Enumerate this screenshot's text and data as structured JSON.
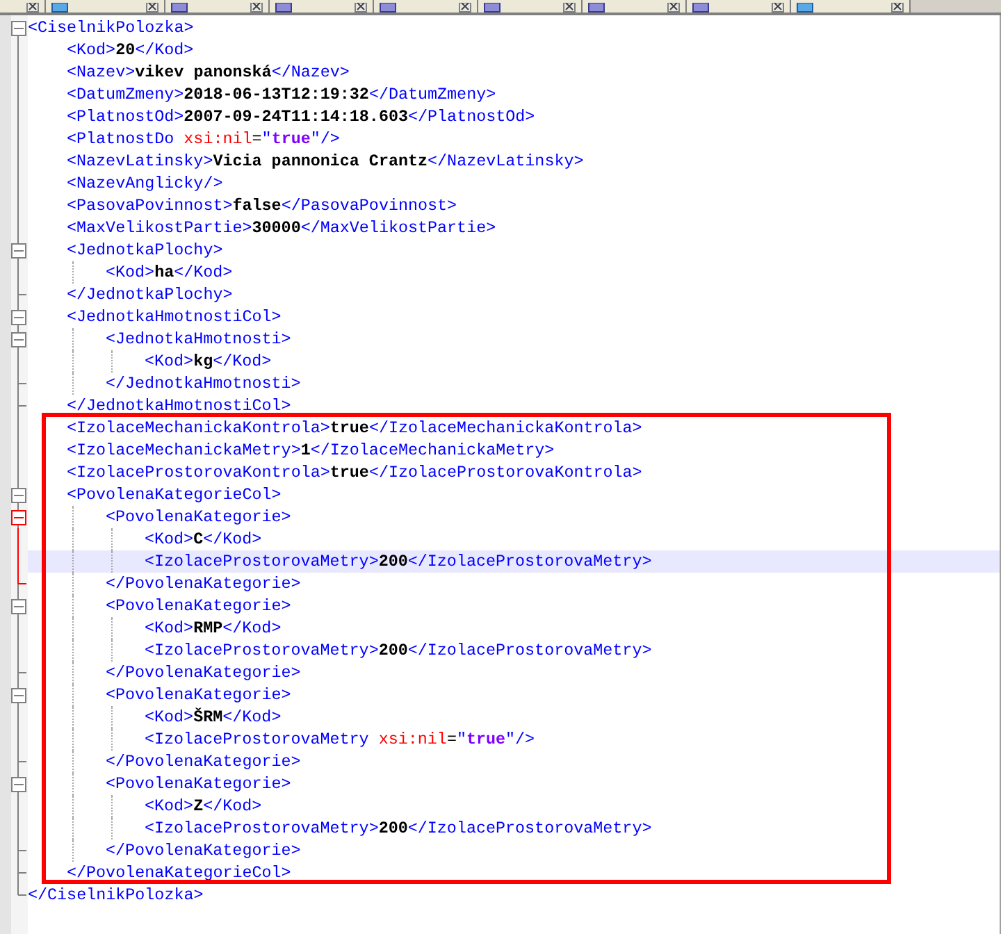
{
  "tabs": [
    {
      "kind": "partial",
      "selected": false
    },
    {
      "kind": "text-file",
      "selected": false
    },
    {
      "kind": "new-file",
      "selected": false
    },
    {
      "kind": "new-file",
      "selected": false
    },
    {
      "kind": "new-file",
      "selected": false
    },
    {
      "kind": "new-file",
      "selected": false
    },
    {
      "kind": "new-file",
      "selected": false
    },
    {
      "kind": "new-file",
      "selected": false
    },
    {
      "kind": "text-file",
      "selected": false
    }
  ],
  "document": {
    "line": [
      {
        "kind": "tag",
        "text": "<CiselnikPolozka>"
      }
    ],
    "expanded": true,
    "current": false,
    "close": [
      {
        "kind": "tag",
        "text": "</CiselnikPolozka>"
      }
    ],
    "children": [
      {
        "kind": "element",
        "current": false,
        "line": [
          {
            "kind": "tag",
            "text": "<Kod>"
          },
          {
            "kind": "text",
            "text": "20"
          },
          {
            "kind": "tag",
            "text": "</Kod>"
          }
        ]
      },
      {
        "kind": "element",
        "current": false,
        "line": [
          {
            "kind": "tag",
            "text": "<Nazev>"
          },
          {
            "kind": "text",
            "text": "vikev panonská"
          },
          {
            "kind": "tag",
            "text": "</Nazev>"
          }
        ]
      },
      {
        "kind": "element",
        "current": false,
        "line": [
          {
            "kind": "tag",
            "text": "<DatumZmeny>"
          },
          {
            "kind": "text",
            "text": "2018-06-13T12:19:32"
          },
          {
            "kind": "tag",
            "text": "</DatumZmeny>"
          }
        ]
      },
      {
        "kind": "element",
        "current": false,
        "line": [
          {
            "kind": "tag",
            "text": "<PlatnostOd>"
          },
          {
            "kind": "text",
            "text": "2007-09-24T11:14:18.603"
          },
          {
            "kind": "tag",
            "text": "</PlatnostOd>"
          }
        ]
      },
      {
        "kind": "element",
        "current": false,
        "line": [
          {
            "kind": "tag",
            "text": "<PlatnostDo "
          },
          {
            "kind": "attr",
            "text": "xsi:nil"
          },
          {
            "kind": "eq",
            "text": "="
          },
          {
            "kind": "tag",
            "text": "\""
          },
          {
            "kind": "attrval",
            "text": "true"
          },
          {
            "kind": "tag",
            "text": "\"/>"
          }
        ]
      },
      {
        "kind": "element",
        "current": false,
        "line": [
          {
            "kind": "tag",
            "text": "<NazevLatinsky>"
          },
          {
            "kind": "text",
            "text": "Vicia pannonica Crantz"
          },
          {
            "kind": "tag",
            "text": "</NazevLatinsky>"
          }
        ]
      },
      {
        "kind": "element",
        "current": false,
        "line": [
          {
            "kind": "tag",
            "text": "<NazevAnglicky/>"
          }
        ]
      },
      {
        "kind": "element",
        "current": false,
        "line": [
          {
            "kind": "tag",
            "text": "<PasovaPovinnost>"
          },
          {
            "kind": "text",
            "text": "false"
          },
          {
            "kind": "tag",
            "text": "</PasovaPovinnost>"
          }
        ]
      },
      {
        "kind": "element",
        "current": false,
        "line": [
          {
            "kind": "tag",
            "text": "<MaxVelikostPartie>"
          },
          {
            "kind": "text",
            "text": "30000"
          },
          {
            "kind": "tag",
            "text": "</MaxVelikostPartie>"
          }
        ]
      },
      {
        "kind": "element",
        "current": false,
        "expanded": true,
        "line": [
          {
            "kind": "tag",
            "text": "<JednotkaPlochy>"
          }
        ],
        "close": [
          {
            "kind": "tag",
            "text": "</JednotkaPlochy>"
          }
        ],
        "children": [
          {
            "current": false,
            "line": [
              {
                "kind": "tag",
                "text": "<Kod>"
              },
              {
                "kind": "text",
                "text": "ha"
              },
              {
                "kind": "tag",
                "text": "</Kod>"
              }
            ]
          }
        ]
      },
      {
        "kind": "element",
        "current": false,
        "expanded": true,
        "line": [
          {
            "kind": "tag",
            "text": "<JednotkaHmotnostiCol>"
          }
        ],
        "close": [
          {
            "kind": "tag",
            "text": "</JednotkaHmotnostiCol>"
          }
        ],
        "children": [
          {
            "current": false,
            "expanded": true,
            "line": [
              {
                "kind": "tag",
                "text": "<JednotkaHmotnosti>"
              }
            ],
            "close": [
              {
                "kind": "tag",
                "text": "</JednotkaHmotnosti>"
              }
            ],
            "children": [
              {
                "current": false,
                "line": [
                  {
                    "kind": "tag",
                    "text": "<Kod>"
                  },
                  {
                    "kind": "text",
                    "text": "kg"
                  },
                  {
                    "kind": "tag",
                    "text": "</Kod>"
                  }
                ]
              }
            ]
          }
        ]
      },
      {
        "kind": "annotation",
        "children": [
          {
            "current": false,
            "line": [
              {
                "kind": "tag",
                "text": "<IzolaceMechanickaKontrola>"
              },
              {
                "kind": "text",
                "text": "true"
              },
              {
                "kind": "tag",
                "text": "</IzolaceMechanickaKontrola>"
              }
            ]
          },
          {
            "current": false,
            "line": [
              {
                "kind": "tag",
                "text": "<IzolaceMechanickaMetry>"
              },
              {
                "kind": "text",
                "text": "1"
              },
              {
                "kind": "tag",
                "text": "</IzolaceMechanickaMetry>"
              }
            ]
          },
          {
            "current": false,
            "line": [
              {
                "kind": "tag",
                "text": "<IzolaceProstorovaKontrola>"
              },
              {
                "kind": "text",
                "text": "true"
              },
              {
                "kind": "tag",
                "text": "</IzolaceProstorovaKontrola>"
              }
            ]
          },
          {
            "current": false,
            "expanded": true,
            "line": [
              {
                "kind": "tag",
                "text": "<PovolenaKategorieCol>"
              }
            ],
            "close": [
              {
                "kind": "tag",
                "text": "</PovolenaKategorieCol>"
              }
            ],
            "children": [
              {
                "current": false,
                "expanded": true,
                "line": [
                  {
                    "kind": "tag",
                    "text": "<PovolenaKategorie>"
                  }
                ],
                "close": [
                  {
                    "kind": "tag",
                    "text": "</PovolenaKategorie>"
                  }
                ],
                "children": [
                  {
                    "current": false,
                    "line": [
                      {
                        "kind": "tag",
                        "text": "<Kod>"
                      },
                      {
                        "kind": "text",
                        "text": "C"
                      },
                      {
                        "kind": "tag",
                        "text": "</Kod>"
                      }
                    ]
                  },
                  {
                    "current": true,
                    "line": [
                      {
                        "kind": "tag",
                        "text": "<IzolaceProstorovaMetry>"
                      },
                      {
                        "kind": "text",
                        "text": "200"
                      },
                      {
                        "kind": "tag",
                        "text": "</IzolaceProstorovaMetry>"
                      }
                    ]
                  }
                ]
              },
              {
                "current": false,
                "expanded": true,
                "line": [
                  {
                    "kind": "tag",
                    "text": "<PovolenaKategorie>"
                  }
                ],
                "close": [
                  {
                    "kind": "tag",
                    "text": "</PovolenaKategorie>"
                  }
                ],
                "children": [
                  {
                    "current": false,
                    "line": [
                      {
                        "kind": "tag",
                        "text": "<Kod>"
                      },
                      {
                        "kind": "text",
                        "text": "RMP"
                      },
                      {
                        "kind": "tag",
                        "text": "</Kod>"
                      }
                    ]
                  },
                  {
                    "current": false,
                    "line": [
                      {
                        "kind": "tag",
                        "text": "<IzolaceProstorovaMetry>"
                      },
                      {
                        "kind": "text",
                        "text": "200"
                      },
                      {
                        "kind": "tag",
                        "text": "</IzolaceProstorovaMetry>"
                      }
                    ]
                  }
                ]
              },
              {
                "current": false,
                "expanded": true,
                "line": [
                  {
                    "kind": "tag",
                    "text": "<PovolenaKategorie>"
                  }
                ],
                "close": [
                  {
                    "kind": "tag",
                    "text": "</PovolenaKategorie>"
                  }
                ],
                "children": [
                  {
                    "current": false,
                    "line": [
                      {
                        "kind": "tag",
                        "text": "<Kod>"
                      },
                      {
                        "kind": "text",
                        "text": "ŠRM"
                      },
                      {
                        "kind": "tag",
                        "text": "</Kod>"
                      }
                    ]
                  },
                  {
                    "current": false,
                    "line": [
                      {
                        "kind": "tag",
                        "text": "<IzolaceProstorovaMetry "
                      },
                      {
                        "kind": "attr",
                        "text": "xsi:nil"
                      },
                      {
                        "kind": "eq",
                        "text": "="
                      },
                      {
                        "kind": "tag",
                        "text": "\""
                      },
                      {
                        "kind": "attrval",
                        "text": "true"
                      },
                      {
                        "kind": "tag",
                        "text": "\"/>"
                      }
                    ]
                  }
                ]
              },
              {
                "current": false,
                "expanded": true,
                "line": [
                  {
                    "kind": "tag",
                    "text": "<PovolenaKategorie>"
                  }
                ],
                "close": [
                  {
                    "kind": "tag",
                    "text": "</PovolenaKategorie>"
                  }
                ],
                "children": [
                  {
                    "current": false,
                    "line": [
                      {
                        "kind": "tag",
                        "text": "<Kod>"
                      },
                      {
                        "kind": "text",
                        "text": "Z"
                      },
                      {
                        "kind": "tag",
                        "text": "</Kod>"
                      }
                    ]
                  },
                  {
                    "current": false,
                    "line": [
                      {
                        "kind": "tag",
                        "text": "<IzolaceProstorovaMetry>"
                      },
                      {
                        "kind": "text",
                        "text": "200"
                      },
                      {
                        "kind": "tag",
                        "text": "</IzolaceProstorovaMetry>"
                      }
                    ]
                  }
                ]
              }
            ]
          }
        ]
      }
    ]
  }
}
